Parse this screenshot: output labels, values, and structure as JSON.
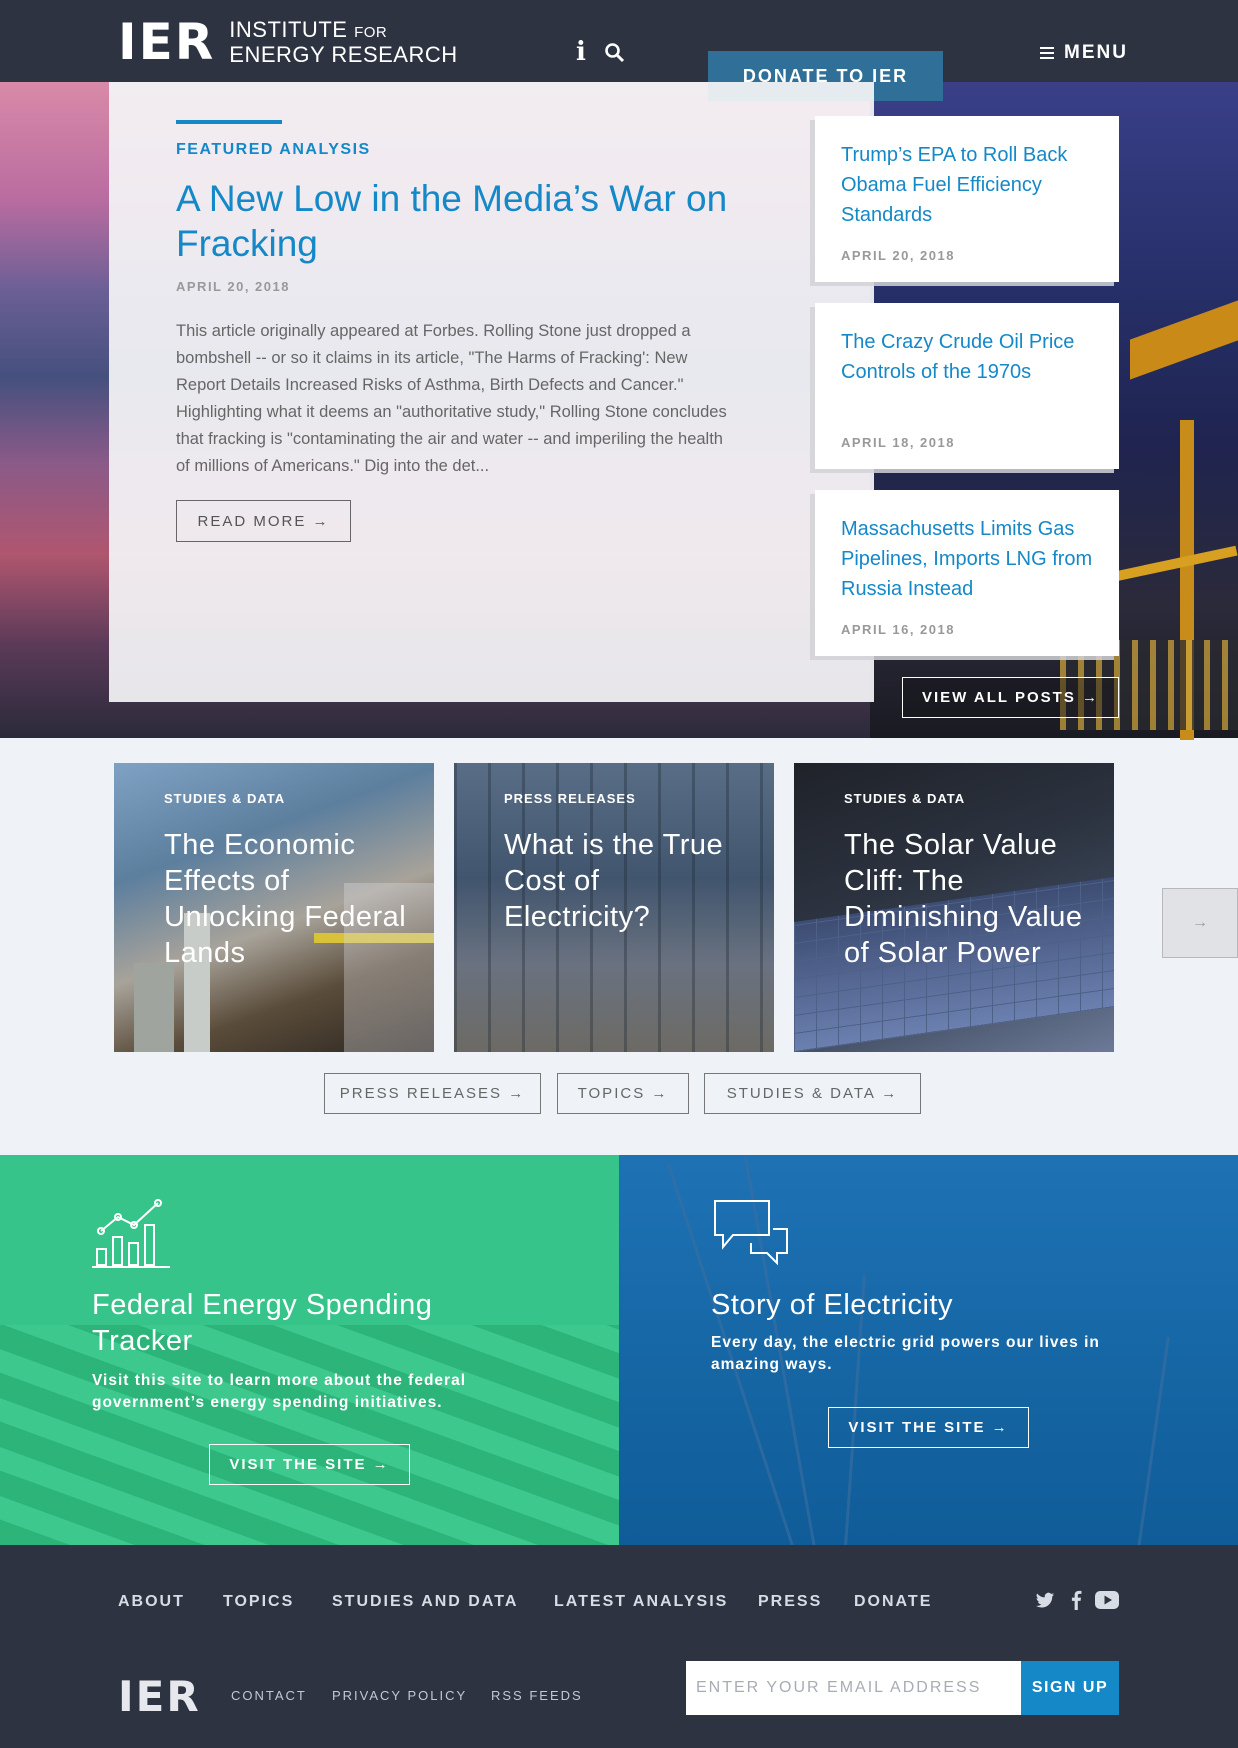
{
  "header": {
    "logo_mark": "IER",
    "logo_line1": "INSTITUTE",
    "logo_for": "FOR",
    "logo_line2": "ENERGY RESEARCH",
    "info_glyph": "i",
    "donate_label": "DONATE TO IER",
    "menu_label": "MENU"
  },
  "featured": {
    "label": "FEATURED ANALYSIS",
    "title": "A New Low in the Media’s War on Fracking",
    "date": "APRIL 20, 2018",
    "excerpt": "This article originally appeared at Forbes. Rolling Stone just dropped a bombshell -- or so it claims in its article, \"The Harms of Fracking': New Report Details Increased Risks of Asthma, Birth Defects and Cancer.\" Highlighting what it deems an \"authoritative study,\" Rolling Stone concludes that fracking is \"contaminating the air and water -- and imperiling the health of millions of Americans.\" Dig into the det...",
    "read_more": "READ MORE →"
  },
  "side_posts": [
    {
      "title": "Trump’s EPA to Roll Back Obama Fuel Efficiency Standards",
      "date": "APRIL 20, 2018"
    },
    {
      "title": "The Crazy Crude Oil Price Controls of the 1970s",
      "date": "APRIL 18, 2018"
    },
    {
      "title": "Massachusetts Limits Gas Pipelines, Imports LNG from Russia Instead",
      "date": "APRIL 16, 2018"
    }
  ],
  "view_all": "VIEW ALL POSTS →",
  "tiles": [
    {
      "category": "STUDIES & DATA",
      "title": "The Economic Effects of Unlocking Federal Lands"
    },
    {
      "category": "PRESS RELEASES",
      "title": "What is the True Cost of Electricity?"
    },
    {
      "category": "STUDIES & DATA",
      "title": "The Solar Value Cliff: The Diminishing Value of Solar Power"
    }
  ],
  "next_arrow": "→",
  "category_buttons": [
    "PRESS RELEASES →",
    "TOPICS →",
    "STUDIES & DATA →"
  ],
  "promos": {
    "left": {
      "title": "Federal Energy Spending Tracker",
      "subtitle": "Visit this site to learn more about the federal government’s energy spending initiatives.",
      "button": "VISIT THE SITE →"
    },
    "right": {
      "title": "Story of Electricity",
      "subtitle": "Every day, the electric grid powers our lives in amazing ways.",
      "button": "VISIT THE SITE →"
    }
  },
  "footer": {
    "nav": [
      "ABOUT",
      "TOPICS",
      "STUDIES AND DATA",
      "LATEST ANALYSIS",
      "PRESS",
      "DONATE"
    ],
    "social": [
      "twitter-icon",
      "facebook-icon",
      "youtube-icon"
    ],
    "logo": "IER",
    "links": [
      "CONTACT",
      "PRIVACY POLICY",
      "RSS FEEDS"
    ],
    "email_placeholder": "ENTER YOUR EMAIL ADDRESS",
    "signup_label": "SIGN UP"
  },
  "colors": {
    "navy": "#2d3340",
    "accent_blue": "#1588c8",
    "donate": "#2f6f98",
    "green": "#36c48a",
    "electric_blue": "#1e72b4"
  }
}
